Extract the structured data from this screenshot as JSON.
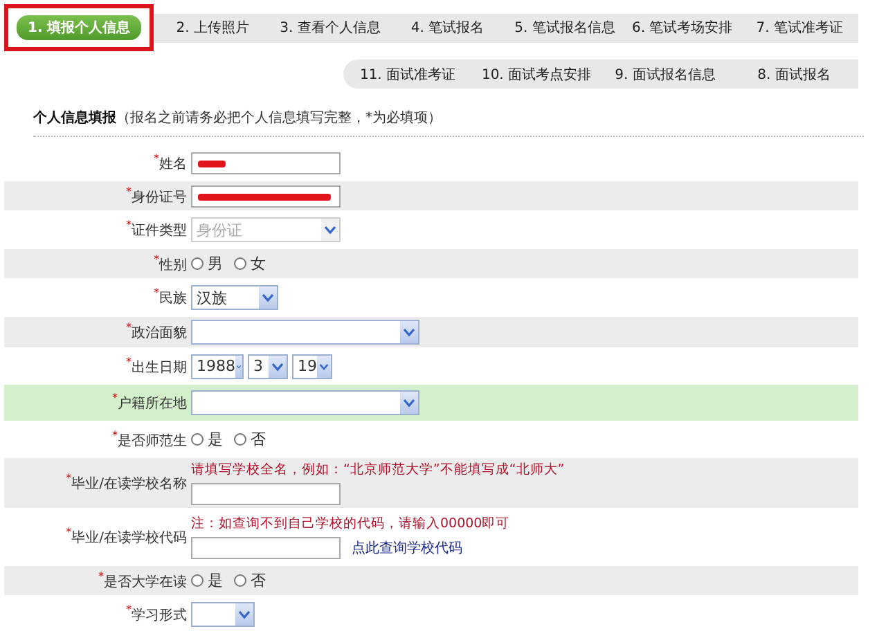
{
  "steps": {
    "row_1": [
      {
        "label": "1. 填报个人信息",
        "selected": true
      },
      {
        "label": "2. 上传照片",
        "selected": false
      },
      {
        "label": "3. 查看个人信息",
        "selected": false
      },
      {
        "label": "4. 笔试报名",
        "selected": false
      },
      {
        "label": "5. 笔试报名信息",
        "selected": false
      },
      {
        "label": "6. 笔试考场安排",
        "selected": false
      },
      {
        "label": "7. 笔试准考证",
        "selected": false
      }
    ],
    "row_2": [
      {
        "label": "11. 面试准考证",
        "selected": false
      },
      {
        "label": "10. 面试考点安排",
        "selected": false
      },
      {
        "label": "9. 面试报名信息",
        "selected": false
      },
      {
        "label": "8. 面试报名",
        "selected": false
      }
    ]
  },
  "section": {
    "title": "个人信息填报",
    "hint": "（报名之前请务必把个人信息填写完整，*为必填项）"
  },
  "form": [
    {
      "kind": "input",
      "label": "$^{*}$姓名",
      "redacted": true,
      "highlighted": false
    },
    {
      "kind": "input",
      "label": "$^{*}$身份证号",
      "redacted": true,
      "highlighted": false
    },
    {
      "kind": "select",
      "label": "$^{*}$证件类型",
      "value": "身份证",
      "disabled": true,
      "highlighted": false
    },
    {
      "kind": "radio",
      "label": "$^{*}$性别",
      "options": [
        {
          "label": "男",
          "selected": false
        },
        {
          "label": "女",
          "selected": false
        }
      ],
      "highlighted": false
    },
    {
      "kind": "select",
      "label": "$^{*}$民族",
      "value": "汉族",
      "disabled": false,
      "highlighted": false
    },
    {
      "kind": "select",
      "label": "$^{*}$政治面貌",
      "disabled": false,
      "highlighted": false
    },
    {
      "kind": "date",
      "label": "$^{*}$出生日期",
      "parts": [
        "1988",
        "3",
        "19"
      ],
      "highlighted": false
    },
    {
      "kind": "select",
      "label": "$^{*}$户籍所在地",
      "disabled": false,
      "highlighted": true
    },
    {
      "kind": "radio",
      "label": "$^{*}$是否师范生",
      "options": [
        {
          "label": "是",
          "selected": false
        },
        {
          "label": "否",
          "selected": false
        }
      ],
      "highlighted": false
    },
    {
      "kind": "input",
      "label": "$^{*}$毕业/在读学校名称",
      "note": "请填写学校全名，例如：“北京师范大学”不能填写成“北师大”",
      "redacted": false,
      "highlighted": false
    },
    {
      "kind": "input",
      "label": "$^{*}$毕业/在读学校代码",
      "note": "注：如查询不到自己学校的代码，请输入00000即可",
      "link": "点此查询学校代码",
      "redacted": false,
      "highlighted": false
    },
    {
      "kind": "radio",
      "label": "$^{*}$是否大学在读",
      "options": [
        {
          "label": "是",
          "selected": false
        },
        {
          "label": "否",
          "selected": false
        }
      ],
      "highlighted": false
    },
    {
      "kind": "select",
      "label": "$^{*}$学习形式",
      "disabled": false,
      "highlighted": false
    }
  ]
}
